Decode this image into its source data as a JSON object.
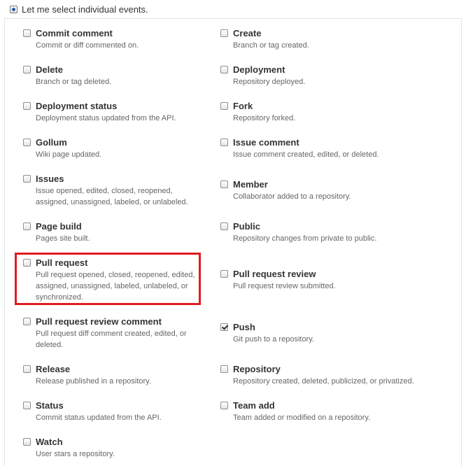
{
  "mode": {
    "label": "Let me select individual events.",
    "selected": true
  },
  "events": [
    {
      "title": "Commit comment",
      "desc": "Commit or diff commented on.",
      "checked": false
    },
    {
      "title": "Create",
      "desc": "Branch or tag created.",
      "checked": false
    },
    {
      "title": "Delete",
      "desc": "Branch or tag deleted.",
      "checked": false
    },
    {
      "title": "Deployment",
      "desc": "Repository deployed.",
      "checked": false
    },
    {
      "title": "Deployment status",
      "desc": "Deployment status updated from the API.",
      "checked": false
    },
    {
      "title": "Fork",
      "desc": "Repository forked.",
      "checked": false
    },
    {
      "title": "Gollum",
      "desc": "Wiki page updated.",
      "checked": false
    },
    {
      "title": "Issue comment",
      "desc": "Issue comment created, edited, or deleted.",
      "checked": false
    },
    {
      "title": "Issues",
      "desc": "Issue opened, edited, closed, reopened, assigned, unassigned, labeled, or unlabeled.",
      "checked": false
    },
    {
      "title": "Member",
      "desc": "Collaborator added to a repository.",
      "checked": false
    },
    {
      "title": "Page build",
      "desc": "Pages site built.",
      "checked": false
    },
    {
      "title": "Public",
      "desc": "Repository changes from private to public.",
      "checked": false
    },
    {
      "title": "Pull request",
      "desc": "Pull request opened, closed, reopened, edited, assigned, unassigned, labeled, unlabeled, or synchronized.",
      "checked": false
    },
    {
      "title": "Pull request review",
      "desc": "Pull request review submitted.",
      "checked": false
    },
    {
      "title": "Pull request review comment",
      "desc": "Pull request diff comment created, edited, or deleted.",
      "checked": false
    },
    {
      "title": "Push",
      "desc": "Git push to a repository.",
      "checked": true
    },
    {
      "title": "Release",
      "desc": "Release published in a repository.",
      "checked": false
    },
    {
      "title": "Repository",
      "desc": "Repository created, deleted, publicized, or privatized.",
      "checked": false
    },
    {
      "title": "Status",
      "desc": "Commit status updated from the API.",
      "checked": false
    },
    {
      "title": "Team add",
      "desc": "Team added or modified on a repository.",
      "checked": false
    },
    {
      "title": "Watch",
      "desc": "User stars a repository.",
      "checked": false
    }
  ],
  "annotation": {
    "highlighted_event": "Pull request",
    "color": "#e11b22"
  }
}
